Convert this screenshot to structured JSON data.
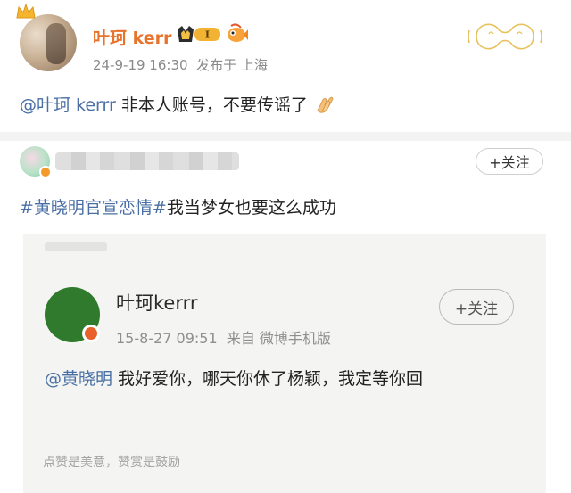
{
  "post": {
    "username": "叶珂 kerr",
    "vip_level": "I",
    "date": "24-9-19 16:30",
    "location": "发布于 上海",
    "mention": "@叶珂 kerrr",
    "body": " 非本人账号，不要传谣了"
  },
  "repost": {
    "follow_label": "+关注",
    "hashtag": "#黄晓明官宣恋情#",
    "body": "我当梦女也要这么成功",
    "embed": {
      "username": "叶珂kerrr",
      "follow_label": "+关注",
      "date": "15-8-27 09:51",
      "source": "来自 微博手机版",
      "mention": "@黄晓明",
      "body": " 我好爱你，哪天你休了杨颖，我定等你回",
      "footer": "点赞是美意，赞赏是鼓励"
    }
  },
  "colors": {
    "username_orange": "#e8732c",
    "link_blue": "#4a6fa5"
  },
  "icons": [
    "crown-icon",
    "vip-badge-icon",
    "fish-icon",
    "clap-hands-icon",
    "verified-icon"
  ]
}
